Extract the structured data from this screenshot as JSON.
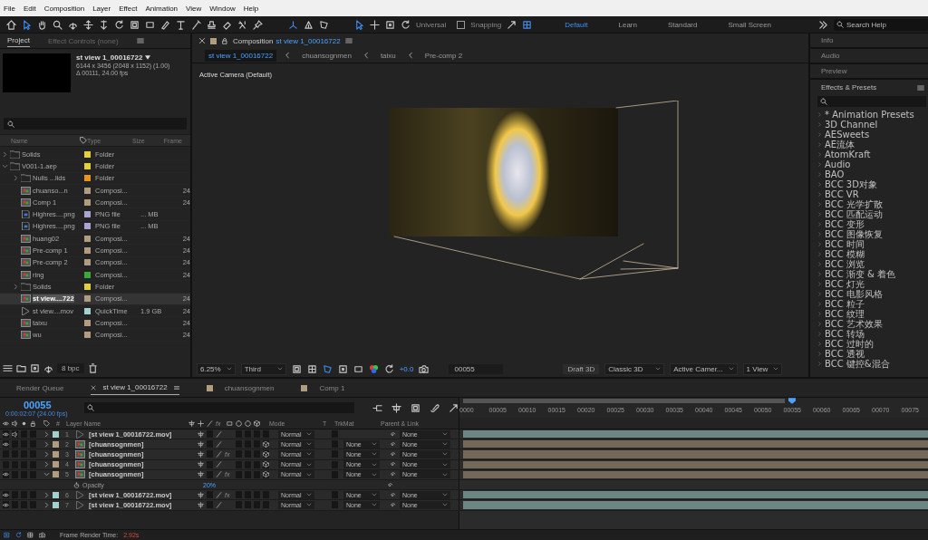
{
  "menu_bar": [
    "File",
    "Edit",
    "Composition",
    "Layer",
    "Effect",
    "Animation",
    "View",
    "Window",
    "Help"
  ],
  "toolbar": {
    "axis_mode": "Universal",
    "snapping": {
      "label": "Snapping",
      "checked": false
    },
    "workspaces": [
      {
        "label": "Default",
        "selected": true
      },
      {
        "label": "Learn",
        "selected": false
      },
      {
        "label": "Standard",
        "selected": false
      },
      {
        "label": "Small Screen",
        "selected": false
      }
    ],
    "search": {
      "placeholder": "Search Help"
    }
  },
  "project": {
    "tabs": [
      {
        "label": "Project",
        "selected": true
      },
      {
        "label": "Effect Controls (none)",
        "selected": false
      }
    ],
    "preview": {
      "name": "st view 1_00016722",
      "details": [
        "6144 x 3456  (2048 x 1152) (1.00)",
        "Δ 00111, 24.00 fps"
      ]
    },
    "columns": [
      "Name",
      "Type",
      "Size",
      "Frame"
    ],
    "items": [
      {
        "name": "Solids",
        "kind": "folder",
        "color": "#e2d03a",
        "type": "Folder",
        "expanded": false,
        "selected": false
      },
      {
        "name": "V001-1.aep",
        "kind": "folder",
        "color": "#e2d03a",
        "type": "Folder",
        "expanded": true,
        "selected": false,
        "children": [
          {
            "name": "Nulls ...lids",
            "kind": "folder",
            "color": "#e8951a",
            "type": "Folder",
            "expanded": false,
            "selected": false
          },
          {
            "name": "chuanso...n",
            "kind": "comp",
            "color": "#b09d7f",
            "type": "Composi...",
            "frame": "24",
            "selected": false
          },
          {
            "name": "Comp 1",
            "kind": "comp",
            "color": "#b09d7f",
            "type": "Composi...",
            "frame": "24",
            "selected": false
          },
          {
            "name": "Highres....png",
            "kind": "image",
            "color": "#a8a5d0",
            "type": "PNG file",
            "size": "... MB",
            "selected": false
          },
          {
            "name": "Highres....png",
            "kind": "image",
            "color": "#a8a5d0",
            "type": "PNG file",
            "size": "... MB",
            "selected": false
          },
          {
            "name": "huang02",
            "kind": "comp",
            "color": "#b09d7f",
            "type": "Composi...",
            "frame": "24",
            "selected": false
          },
          {
            "name": "Pre-comp 1",
            "kind": "comp",
            "color": "#b09d7f",
            "type": "Composi...",
            "frame": "24",
            "selected": false
          },
          {
            "name": "Pre-comp 2",
            "kind": "comp",
            "color": "#b09d7f",
            "type": "Composi...",
            "frame": "24",
            "selected": false
          },
          {
            "name": "ring",
            "kind": "comp",
            "color": "#3aa83a",
            "type": "Composi...",
            "frame": "24",
            "selected": false
          },
          {
            "name": "Solids",
            "kind": "folder",
            "color": "#e2d03a",
            "type": "Folder",
            "expanded": false,
            "selected": false
          },
          {
            "name": "st view....722",
            "kind": "comp",
            "color": "#b09d7f",
            "type": "Composi...",
            "frame": "24",
            "selected": true
          },
          {
            "name": "st view....mov",
            "kind": "footage",
            "color": "#a2d2cd",
            "type": "QuickTime",
            "size": "1.9 GB",
            "frame": "24",
            "selected": false
          },
          {
            "name": "taixu",
            "kind": "comp",
            "color": "#b09d7f",
            "type": "Composi...",
            "frame": "24",
            "selected": false
          },
          {
            "name": "wu",
            "kind": "comp",
            "color": "#b09d7f",
            "type": "Composi...",
            "frame": "24",
            "selected": false
          }
        ]
      }
    ],
    "bit_depth": "8 bpc"
  },
  "viewer": {
    "header": {
      "title": "Composition",
      "comp_name": "st view 1_00016722"
    },
    "breadcrumbs": [
      {
        "label": "st view 1_00016722",
        "selected": true
      },
      {
        "label": "chuansognmen",
        "selected": false
      },
      {
        "label": "taixu",
        "selected": false
      },
      {
        "label": "Pre-comp 2",
        "selected": false
      }
    ],
    "camera_label": "Active Camera (Default)",
    "controls": {
      "zoom": "6.25%",
      "resolution": "Third",
      "exposure": "+0.0",
      "timecode": "00055",
      "draft_3d": "Draft 3D",
      "renderer": "Classic 3D",
      "camera": "Active Camer...",
      "views": "1 View"
    }
  },
  "right_panel": {
    "panels": [
      "Info",
      "Audio",
      "Preview"
    ],
    "effects": {
      "title": "Effects & Presets",
      "items": [
        "* Animation Presets",
        "3D Channel",
        "AESweets",
        "AE流体",
        "AtomKraft",
        "Audio",
        "BAO",
        "BCC 3D对象",
        "BCC VR",
        "BCC 光学扩散",
        "BCC 匹配运动",
        "BCC 变形",
        "BCC 图像恢复",
        "BCC 时间",
        "BCC 模糊",
        "BCC 浏览",
        "BCC 渐变 & 着色",
        "BCC 灯光",
        "BCC 电影风格",
        "BCC 粒子",
        "BCC 纹理",
        "BCC 艺术效果",
        "BCC 转场",
        "BCC 过时的",
        "BCC 透视",
        "BCC 键控&混合"
      ]
    }
  },
  "timeline": {
    "tabs": [
      {
        "label": "Render Queue",
        "kind": "queue",
        "selected": false
      },
      {
        "label": "st view 1_00016722",
        "kind": "comp",
        "selected": true
      },
      {
        "label": "chuansognmen",
        "kind": "comp",
        "selected": false
      },
      {
        "label": "Comp 1",
        "kind": "comp",
        "selected": false
      }
    ],
    "current_time": "00055",
    "time_detail": "0:00:02:07 (24.00 fps)",
    "columns": {
      "number": "#",
      "layer_name": "Layer Name",
      "fx": "fx",
      "mode": "Mode",
      "t": "T",
      "trkmat": "TrkMat",
      "parent": "Parent & Link"
    },
    "ruler": [
      "0000",
      "00005",
      "00010",
      "00015",
      "00020",
      "00025",
      "00030",
      "00035",
      "00040",
      "00045",
      "00050",
      "00055",
      "00060",
      "00065",
      "00070",
      "00075"
    ],
    "playhead": {
      "level": 0.71
    },
    "layers": [
      {
        "number": "1",
        "name": "[st view 1_00016722.mov]",
        "kind": "footage",
        "color": "#a2d2cd",
        "visible": true,
        "audio": true,
        "expanded": false,
        "three_d": false,
        "mode": "Normal",
        "parent": "None"
      },
      {
        "number": "2",
        "name": "[chuansognmen]",
        "kind": "comp",
        "color": "#b09d7f",
        "visible": true,
        "audio": false,
        "expanded": false,
        "three_d": true,
        "mode": "Normal",
        "trkmat": "None",
        "parent": "None"
      },
      {
        "number": "3",
        "name": "[chuansognmen]",
        "kind": "comp",
        "color": "#b09d7f",
        "visible": false,
        "audio": false,
        "expanded": false,
        "three_d": true,
        "effects": "fx",
        "mode": "Normal",
        "trkmat": "None",
        "parent": "None"
      },
      {
        "number": "4",
        "name": "[chuansognmen]",
        "kind": "comp",
        "color": "#b09d7f",
        "visible": false,
        "audio": false,
        "expanded": false,
        "three_d": true,
        "mode": "Normal",
        "trkmat": "None",
        "parent": "None"
      },
      {
        "number": "5",
        "name": "[chuansognmen]",
        "kind": "comp",
        "color": "#b09d7f",
        "visible": true,
        "audio": false,
        "expanded": true,
        "three_d": true,
        "effects": "fx",
        "mode": "Normal",
        "trkmat": "None",
        "parent": "None",
        "properties": [
          {
            "name": "Opacity",
            "value": "20%"
          }
        ]
      },
      {
        "number": "6",
        "name": "[st view 1_00016722.mov]",
        "kind": "footage",
        "color": "#a2d2cd",
        "visible": true,
        "audio": false,
        "expanded": false,
        "three_d": false,
        "effects": "fx",
        "mode": "Normal",
        "trkmat": "None",
        "parent": "None"
      },
      {
        "number": "7",
        "name": "[st view 1_00016722.mov]",
        "kind": "footage",
        "color": "#a2d2cd",
        "visible": true,
        "audio": false,
        "expanded": false,
        "three_d": false,
        "mode": "Normal",
        "trkmat": "None",
        "parent": "None"
      }
    ],
    "status": {
      "label": "Frame Render Time:",
      "value": "2.92s"
    }
  }
}
